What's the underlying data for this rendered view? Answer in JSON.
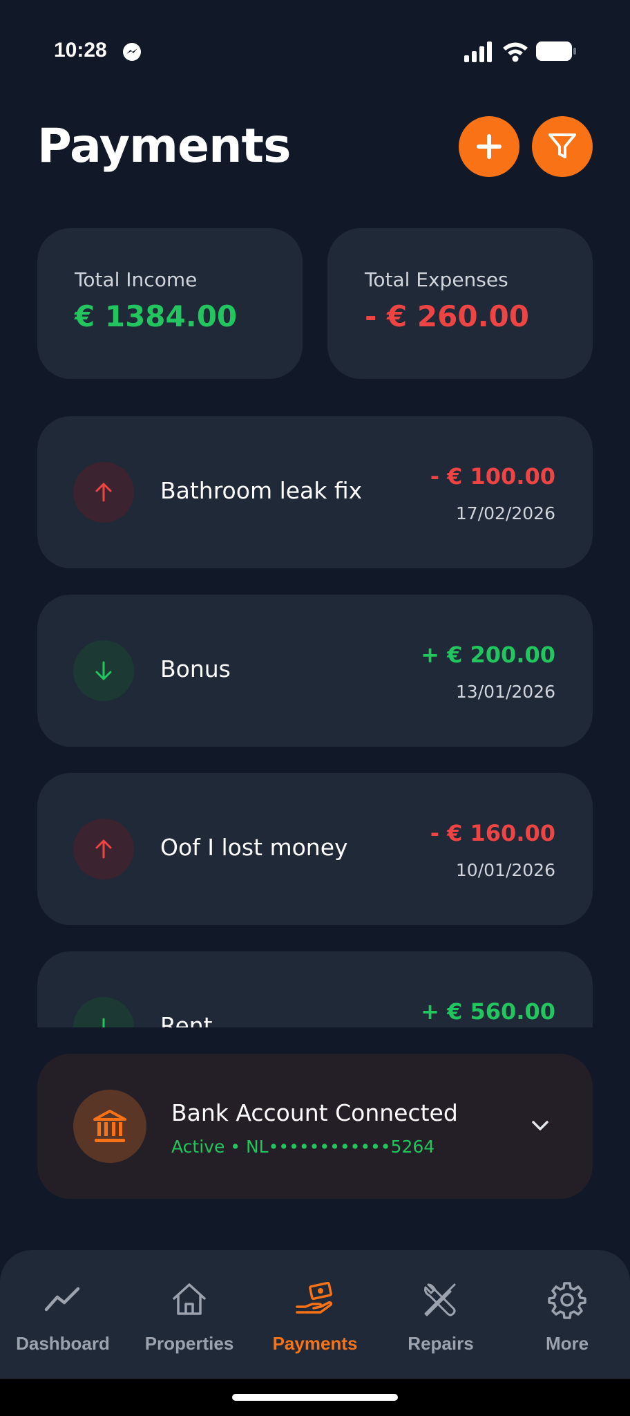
{
  "status": {
    "time": "10:28"
  },
  "header": {
    "title": "Payments"
  },
  "summary": {
    "income_label": "Total Income",
    "income_value": "€ 1384.00",
    "expenses_label": "Total Expenses",
    "expenses_value": "- € 260.00"
  },
  "transactions": [
    {
      "title": "Bathroom leak fix",
      "amount": "- € 100.00",
      "date": "17/02/2026",
      "direction": "out"
    },
    {
      "title": "Bonus",
      "amount": "+ € 200.00",
      "date": "13/01/2026",
      "direction": "in"
    },
    {
      "title": "Oof I lost money",
      "amount": "- € 160.00",
      "date": "10/01/2026",
      "direction": "out"
    },
    {
      "title": "Rent",
      "amount": "+ € 560.00",
      "date": "",
      "direction": "in"
    }
  ],
  "bank": {
    "title": "Bank Account Connected",
    "subtitle": "Active • NL••••••••••••5264"
  },
  "nav": [
    {
      "label": "Dashboard",
      "icon": "chart-line-icon"
    },
    {
      "label": "Properties",
      "icon": "house-icon"
    },
    {
      "label": "Payments",
      "icon": "hand-money-icon",
      "active": true
    },
    {
      "label": "Repairs",
      "icon": "tools-icon"
    },
    {
      "label": "More",
      "icon": "gear-icon"
    }
  ],
  "colors": {
    "background": "#111827",
    "card": "#1f2937",
    "accent": "#f97316",
    "income": "#22c55e",
    "expense": "#ef4444"
  }
}
